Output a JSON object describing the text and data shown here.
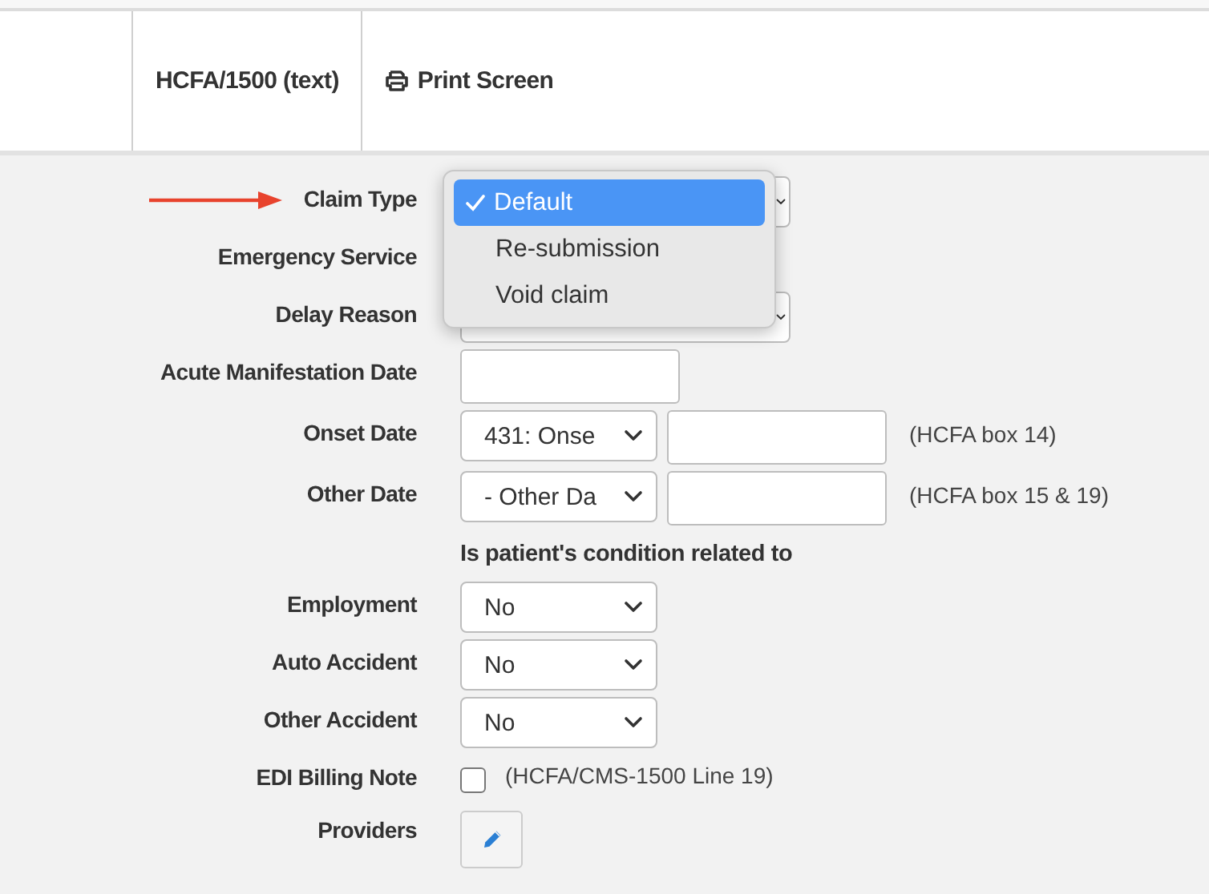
{
  "header": {
    "cells": [
      {
        "kind": "blank"
      },
      {
        "kind": "text",
        "label": "HCFA/1500 (text)"
      },
      {
        "kind": "print",
        "label": "Print Screen"
      }
    ]
  },
  "form": {
    "rows": [
      {
        "kind": "select-wide",
        "label": "Claim Type",
        "pointed": true,
        "dropdown": {
          "options": [
            {
              "label": "Default",
              "selected": true
            },
            {
              "label": "Re-submission",
              "selected": false
            },
            {
              "label": "Void claim",
              "selected": false
            }
          ]
        }
      },
      {
        "kind": "hidden",
        "label": "Emergency Service"
      },
      {
        "kind": "select-wide",
        "label": "Delay Reason"
      },
      {
        "kind": "text",
        "label": "Acute Manifestation Date"
      },
      {
        "kind": "select-date",
        "label": "Onset Date",
        "value": "431: Onse",
        "note": "(HCFA box 14)"
      },
      {
        "kind": "select-date",
        "label": "Other Date",
        "value": "- Other Da",
        "note": "(HCFA box 15 & 19)"
      },
      {
        "kind": "heading",
        "label": "Is patient's condition related to"
      },
      {
        "kind": "select",
        "label": "Employment",
        "value": "No"
      },
      {
        "kind": "select",
        "label": "Auto Accident",
        "value": "No"
      },
      {
        "kind": "select",
        "label": "Other Accident",
        "value": "No"
      },
      {
        "kind": "checkbox",
        "label": "EDI Billing Note",
        "checked": false,
        "note": "(HCFA/CMS-1500 Line 19)"
      },
      {
        "kind": "edit",
        "label": "Providers"
      }
    ]
  }
}
